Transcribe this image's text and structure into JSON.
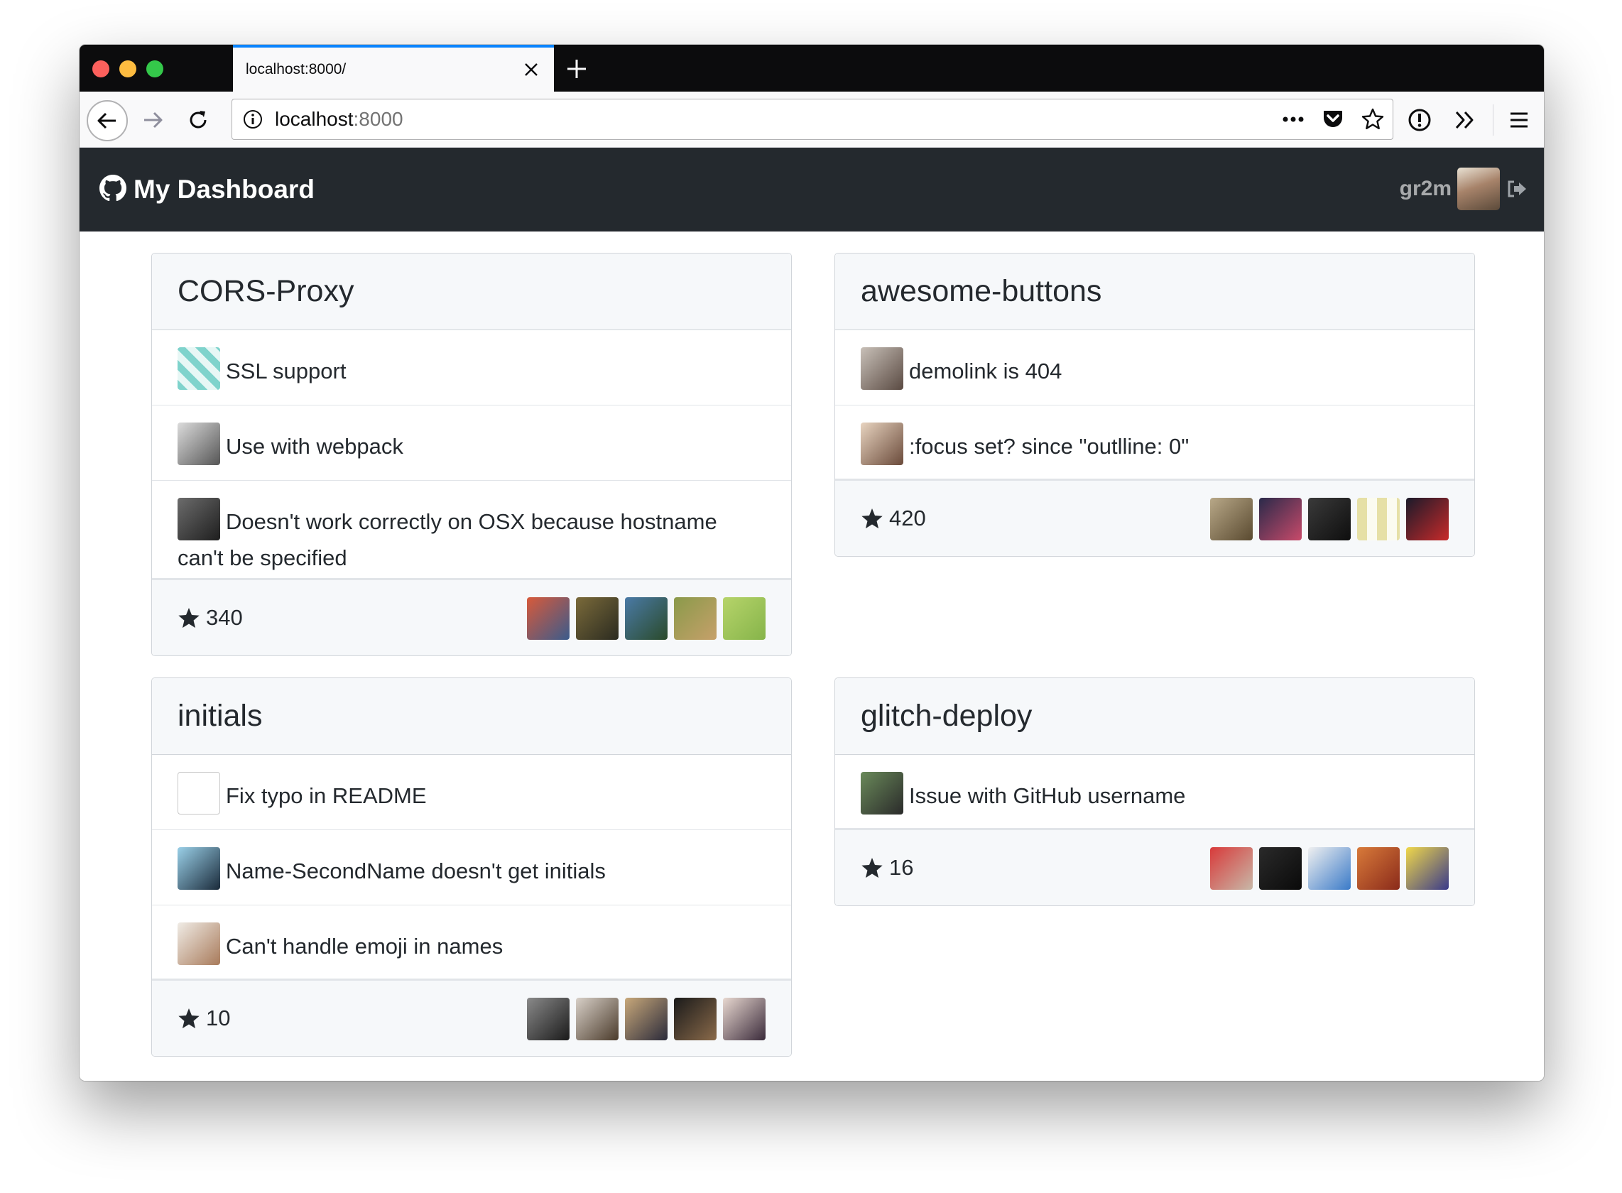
{
  "browser": {
    "tab": {
      "title": "localhost:8000/"
    },
    "url": {
      "host": "localhost",
      "port": ":8000"
    },
    "icons": {
      "close": "close-icon",
      "new_tab": "plus-icon",
      "back": "arrow-left-icon",
      "forward": "arrow-right-icon",
      "reload": "reload-icon",
      "info": "info-icon",
      "page_actions": "ellipsis-icon",
      "pocket": "pocket-icon",
      "bookmark": "star-outline-icon",
      "extension": "exclamation-circle-icon",
      "overflow": "double-chevron-icon",
      "menu": "hamburger-icon"
    },
    "colors": {
      "tab_accent": "#0a84ff",
      "close_light": "#fc605c",
      "minimize_light": "#fdbc40",
      "zoom_light": "#34c84a"
    }
  },
  "header": {
    "title": "My Dashboard",
    "logo_icon": "github-octocat-icon",
    "username": "gr2m",
    "signout_icon": "sign-out-icon",
    "background": "#24292e"
  },
  "repos": [
    {
      "name": "CORS-Proxy",
      "issues": [
        {
          "title": "SSL support"
        },
        {
          "title": "Use with webpack"
        },
        {
          "title": "Doesn't work correctly on OSX because hostname can't be specified"
        }
      ],
      "stars": "340"
    },
    {
      "name": "awesome-buttons",
      "issues": [
        {
          "title": "demolink is 404"
        },
        {
          "title": ":focus set? since \"outlline: 0\""
        }
      ],
      "stars": "420"
    },
    {
      "name": "initials",
      "issues": [
        {
          "title": "Fix typo in README"
        },
        {
          "title": "Name-SecondName doesn't get initials"
        },
        {
          "title": "Can't handle emoji in names"
        }
      ],
      "stars": "10"
    },
    {
      "name": "glitch-deploy",
      "issues": [
        {
          "title": "Issue with GitHub username"
        }
      ],
      "stars": "16"
    }
  ]
}
